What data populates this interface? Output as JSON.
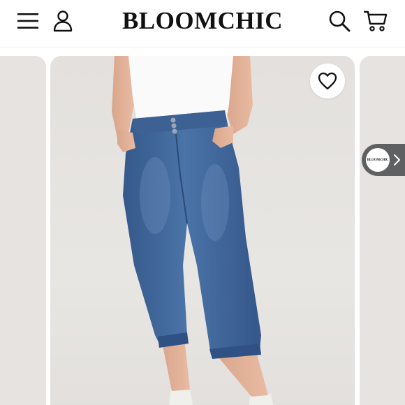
{
  "header": {
    "logo_text": "BLOOMCHIC",
    "menu_icon": "hamburger-menu-icon",
    "account_icon": "user-account-icon",
    "search_icon": "search-icon",
    "cart_icon": "shopping-cart-icon"
  },
  "product_gallery": {
    "wishlist_icon": "heart-outline-icon",
    "store_chip": {
      "logo_text": "BLOOMCHIC",
      "arrow_icon": "chevron-right-icon"
    }
  },
  "colors": {
    "brand_text": "#111111",
    "card_background": "#e6e3e1",
    "chip_background": "#5f6062",
    "denim": "#3f6496"
  }
}
